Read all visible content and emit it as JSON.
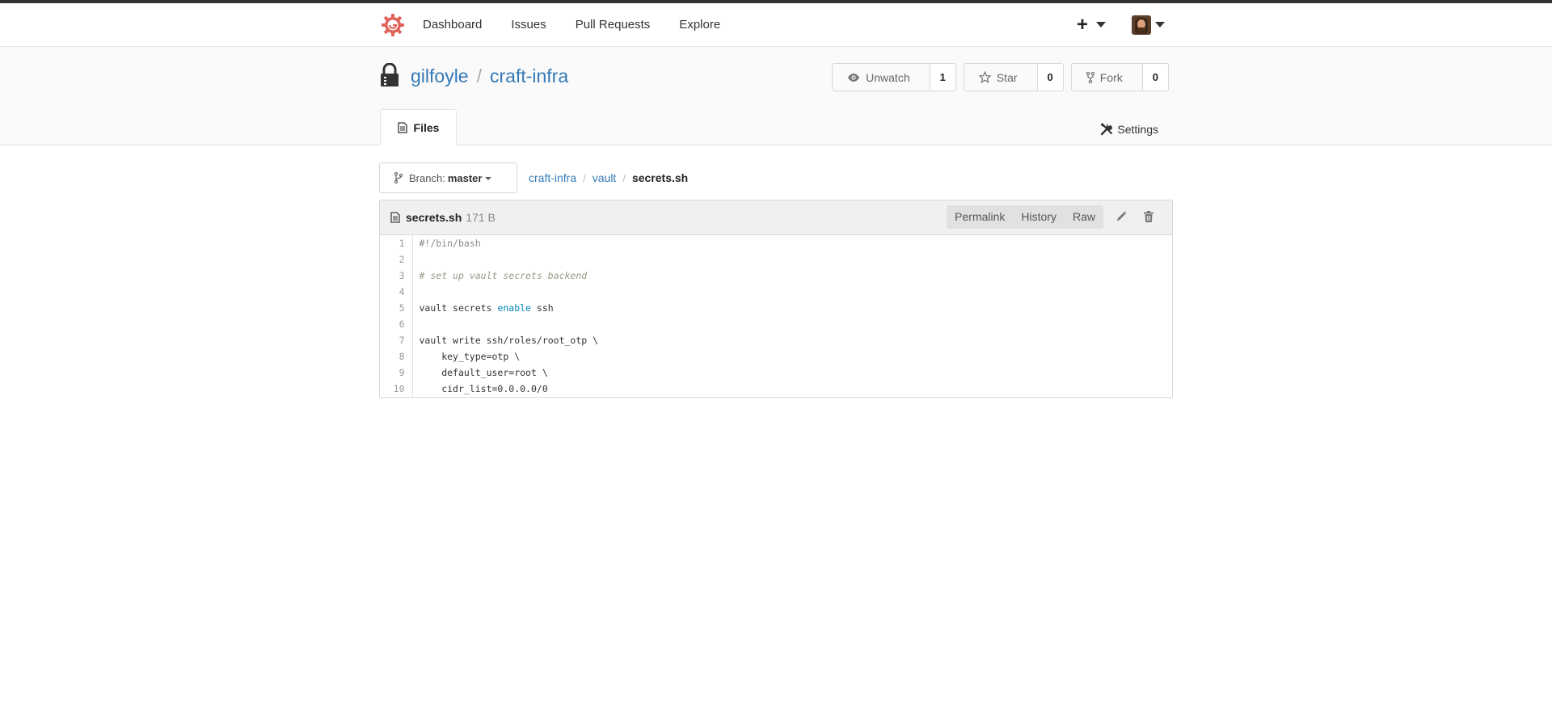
{
  "nav": {
    "items": [
      "Dashboard",
      "Issues",
      "Pull Requests",
      "Explore"
    ],
    "plus": "+"
  },
  "repo": {
    "owner": "gilfoyle",
    "separator": "/",
    "name": "craft-infra",
    "watch": {
      "label": "Unwatch",
      "count": "1"
    },
    "star": {
      "label": "Star",
      "count": "0"
    },
    "fork": {
      "label": "Fork",
      "count": "0"
    }
  },
  "tabs": {
    "files": "Files",
    "settings": "Settings"
  },
  "branch": {
    "prefix": "Branch:",
    "name": "master"
  },
  "breadcrumb": {
    "root": "craft-infra",
    "dir": "vault",
    "file": "secrets.sh",
    "sep": "/"
  },
  "file": {
    "name": "secrets.sh",
    "size": "171 B",
    "actions": [
      "Permalink",
      "History",
      "Raw"
    ],
    "lines": [
      {
        "n": "1",
        "parts": [
          {
            "t": "#!/bin/bash",
            "c": "tok-meta"
          }
        ]
      },
      {
        "n": "2",
        "parts": []
      },
      {
        "n": "3",
        "parts": [
          {
            "t": "# set up vault secrets backend",
            "c": "tok-comment"
          }
        ]
      },
      {
        "n": "4",
        "parts": []
      },
      {
        "n": "5",
        "parts": [
          {
            "t": "vault secrets ",
            "c": ""
          },
          {
            "t": "enable",
            "c": "tok-builtin"
          },
          {
            "t": " ssh",
            "c": ""
          }
        ]
      },
      {
        "n": "6",
        "parts": []
      },
      {
        "n": "7",
        "parts": [
          {
            "t": "vault write ssh/roles/root_otp \\",
            "c": ""
          }
        ]
      },
      {
        "n": "8",
        "parts": [
          {
            "t": "    key_type=otp \\",
            "c": ""
          }
        ]
      },
      {
        "n": "9",
        "parts": [
          {
            "t": "    default_user=root \\",
            "c": ""
          }
        ]
      },
      {
        "n": "10",
        "parts": [
          {
            "t": "    cidr_list=0.0.0.0/0",
            "c": ""
          }
        ]
      }
    ]
  },
  "colors": {
    "logo": "#e0625b",
    "link": "#337ab7",
    "topbar": "#333333"
  }
}
